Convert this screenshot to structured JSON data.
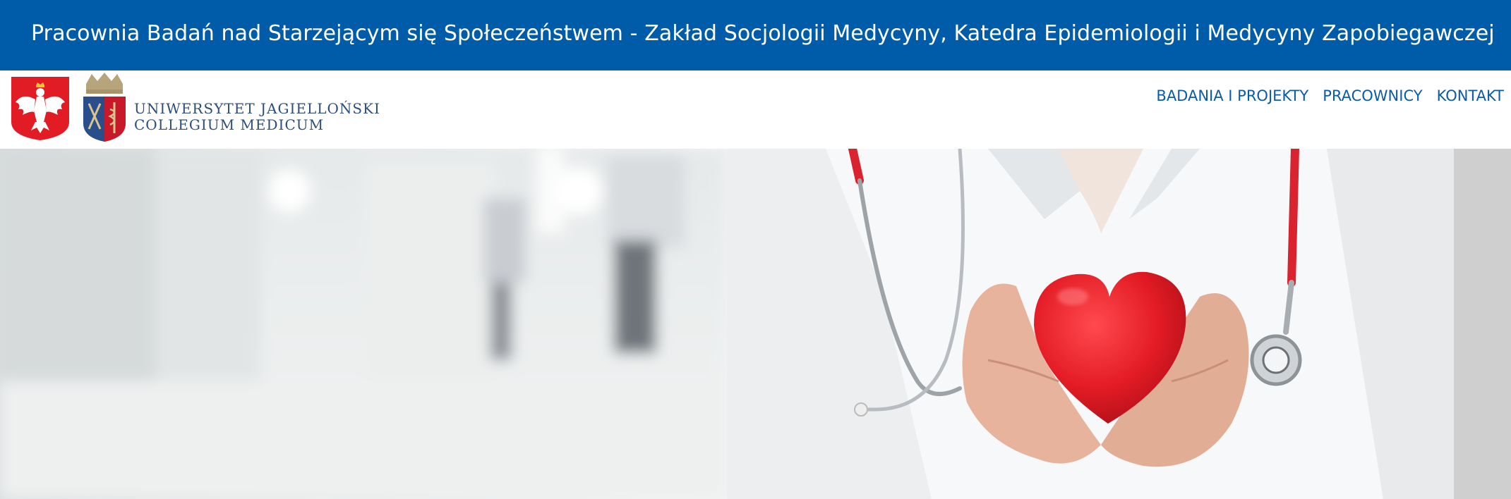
{
  "header": {
    "title": "Pracownia Badań nad Starzejącym się Społeczeństwem - Zakład Socjologii Medycyny, Katedra Epidemiologii i Medycyny Zapobiegawczej"
  },
  "logos": {
    "line1": "UNIWERSYTET JAGIELLOŃSKI",
    "line2": "COLLEGIUM MEDICUM"
  },
  "nav": {
    "items": [
      {
        "label": "BADANIA I PROJEKTY"
      },
      {
        "label": "PRACOWNICY"
      },
      {
        "label": "KONTAKT"
      }
    ]
  },
  "colors": {
    "brand_blue": "#005ca9",
    "nav_blue": "#0a5ba8",
    "heart_red": "#e21c24"
  },
  "hero": {
    "image": "doctor-holding-red-heart-photo"
  }
}
